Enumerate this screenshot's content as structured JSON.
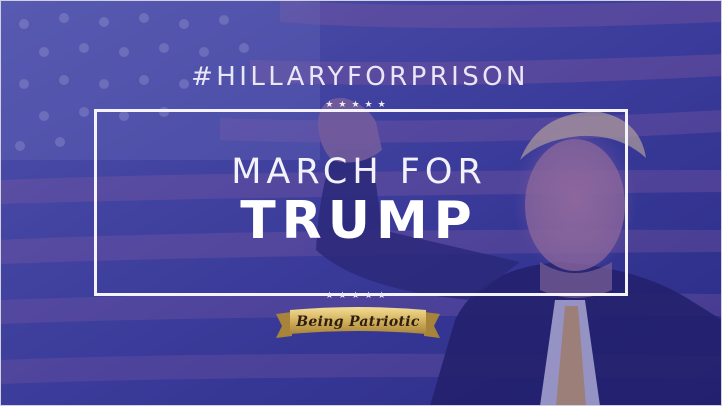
{
  "poster": {
    "hashtag": "#HILLARYFORPRISON",
    "stars": "★★★★★",
    "headline_top": "MARCH FOR",
    "headline_main": "TRUMP",
    "badge": "Being Patriotic"
  },
  "colors": {
    "overlay": "#2e2f86",
    "text": "#ffffff",
    "badge_gold": "#d4b25e"
  }
}
